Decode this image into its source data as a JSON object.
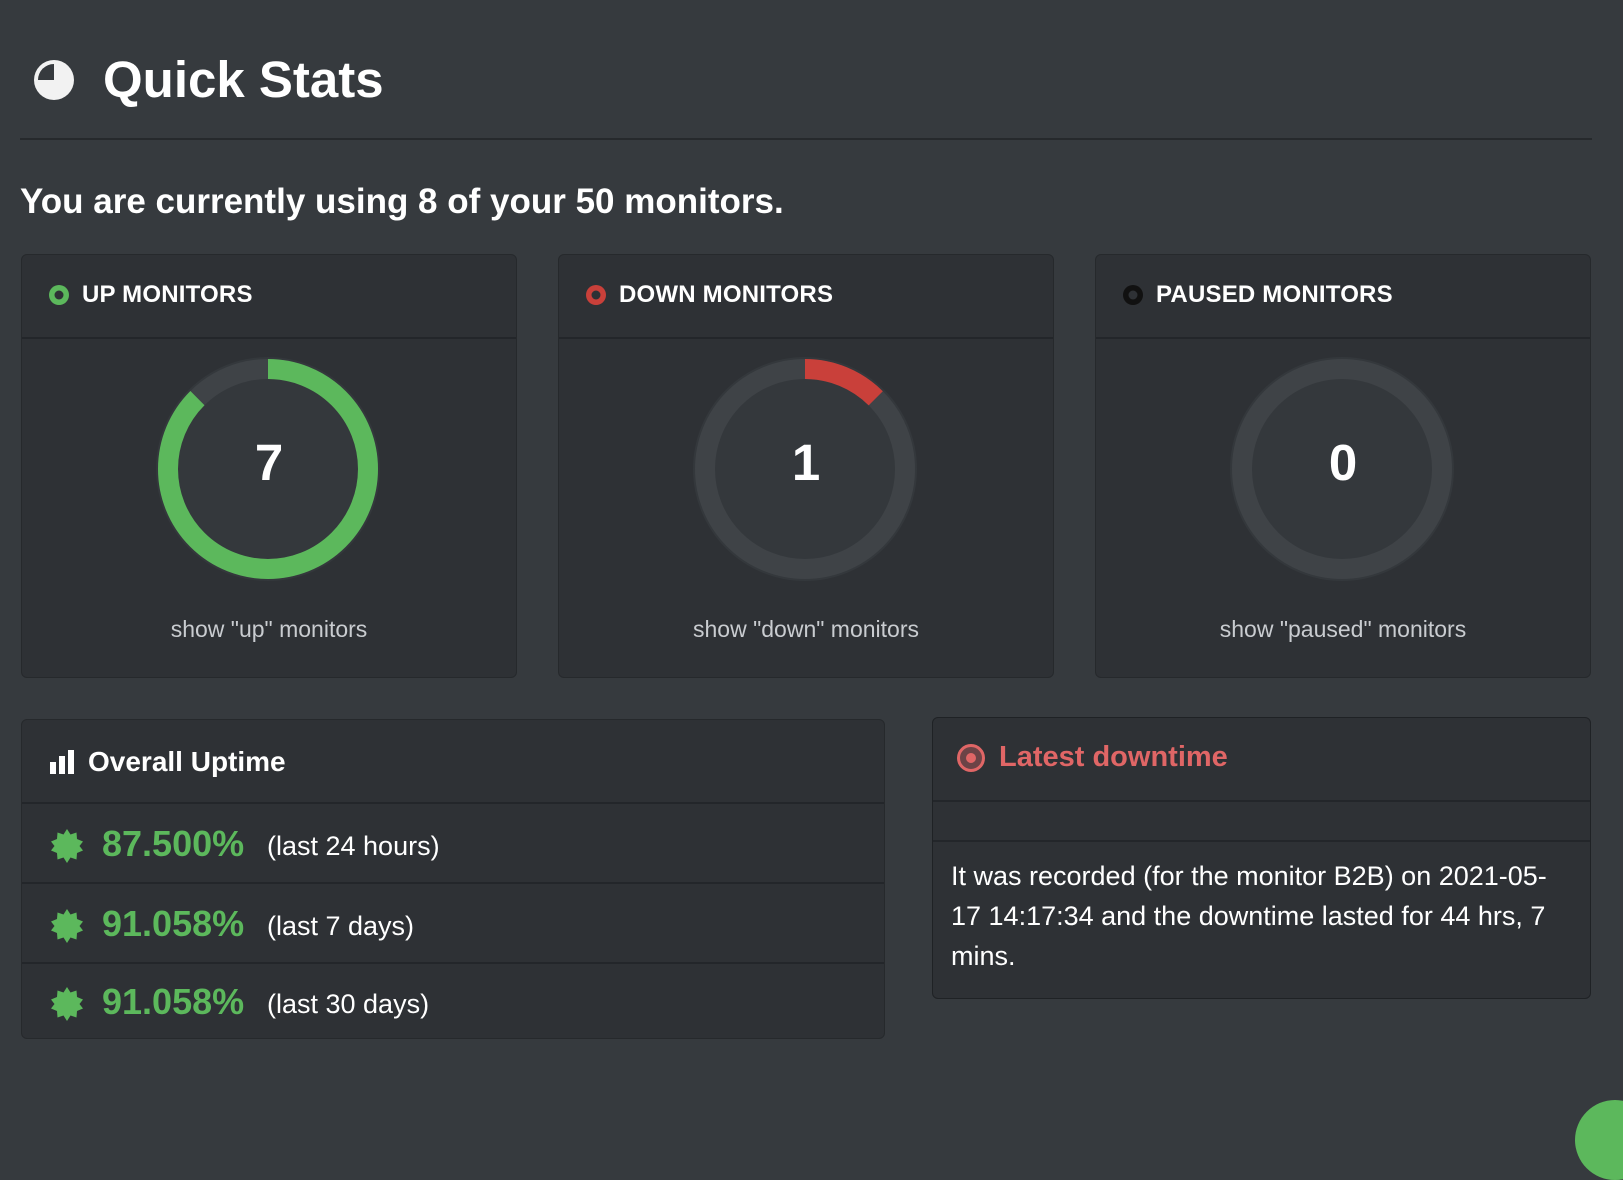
{
  "page": {
    "title": "Quick Stats",
    "title_icon": "pie-chart-icon",
    "usage_text": "You are currently using 8 of your 50 monitors."
  },
  "colors": {
    "background": "#363a3e",
    "card": "#2e3135",
    "up": "#5cb85c",
    "down": "#c9403a",
    "down_text": "#e06666",
    "paused": "#111111",
    "ring_track": "#3f4347"
  },
  "status_cards": [
    {
      "label": "UP MONITORS",
      "count": "7",
      "link": "show \"up\" monitors",
      "ring_fraction": 0.875
    },
    {
      "label": "DOWN MONITORS",
      "count": "1",
      "link": "show \"down\" monitors",
      "ring_fraction": 0.125
    },
    {
      "label": "PAUSED MONITORS",
      "count": "0",
      "link": "show \"paused\" monitors",
      "ring_fraction": 0
    }
  ],
  "uptime": {
    "title": "Overall Uptime",
    "icon": "bar-chart-icon",
    "rows": [
      {
        "value": "87.500%",
        "period": "(last 24 hours)",
        "icon": "certificate-badge-icon"
      },
      {
        "value": "91.058%",
        "period": "(last 7 days)",
        "icon": "certificate-badge-icon"
      },
      {
        "value": "91.058%",
        "period": "(last 30 days)",
        "icon": "certificate-badge-icon"
      }
    ]
  },
  "latest_downtime": {
    "title": "Latest downtime",
    "icon": "record-icon",
    "text": "It was recorded (for the monitor B2B) on 2021-05-17 14:17:34 and the downtime lasted for 44 hrs, 7 mins."
  }
}
